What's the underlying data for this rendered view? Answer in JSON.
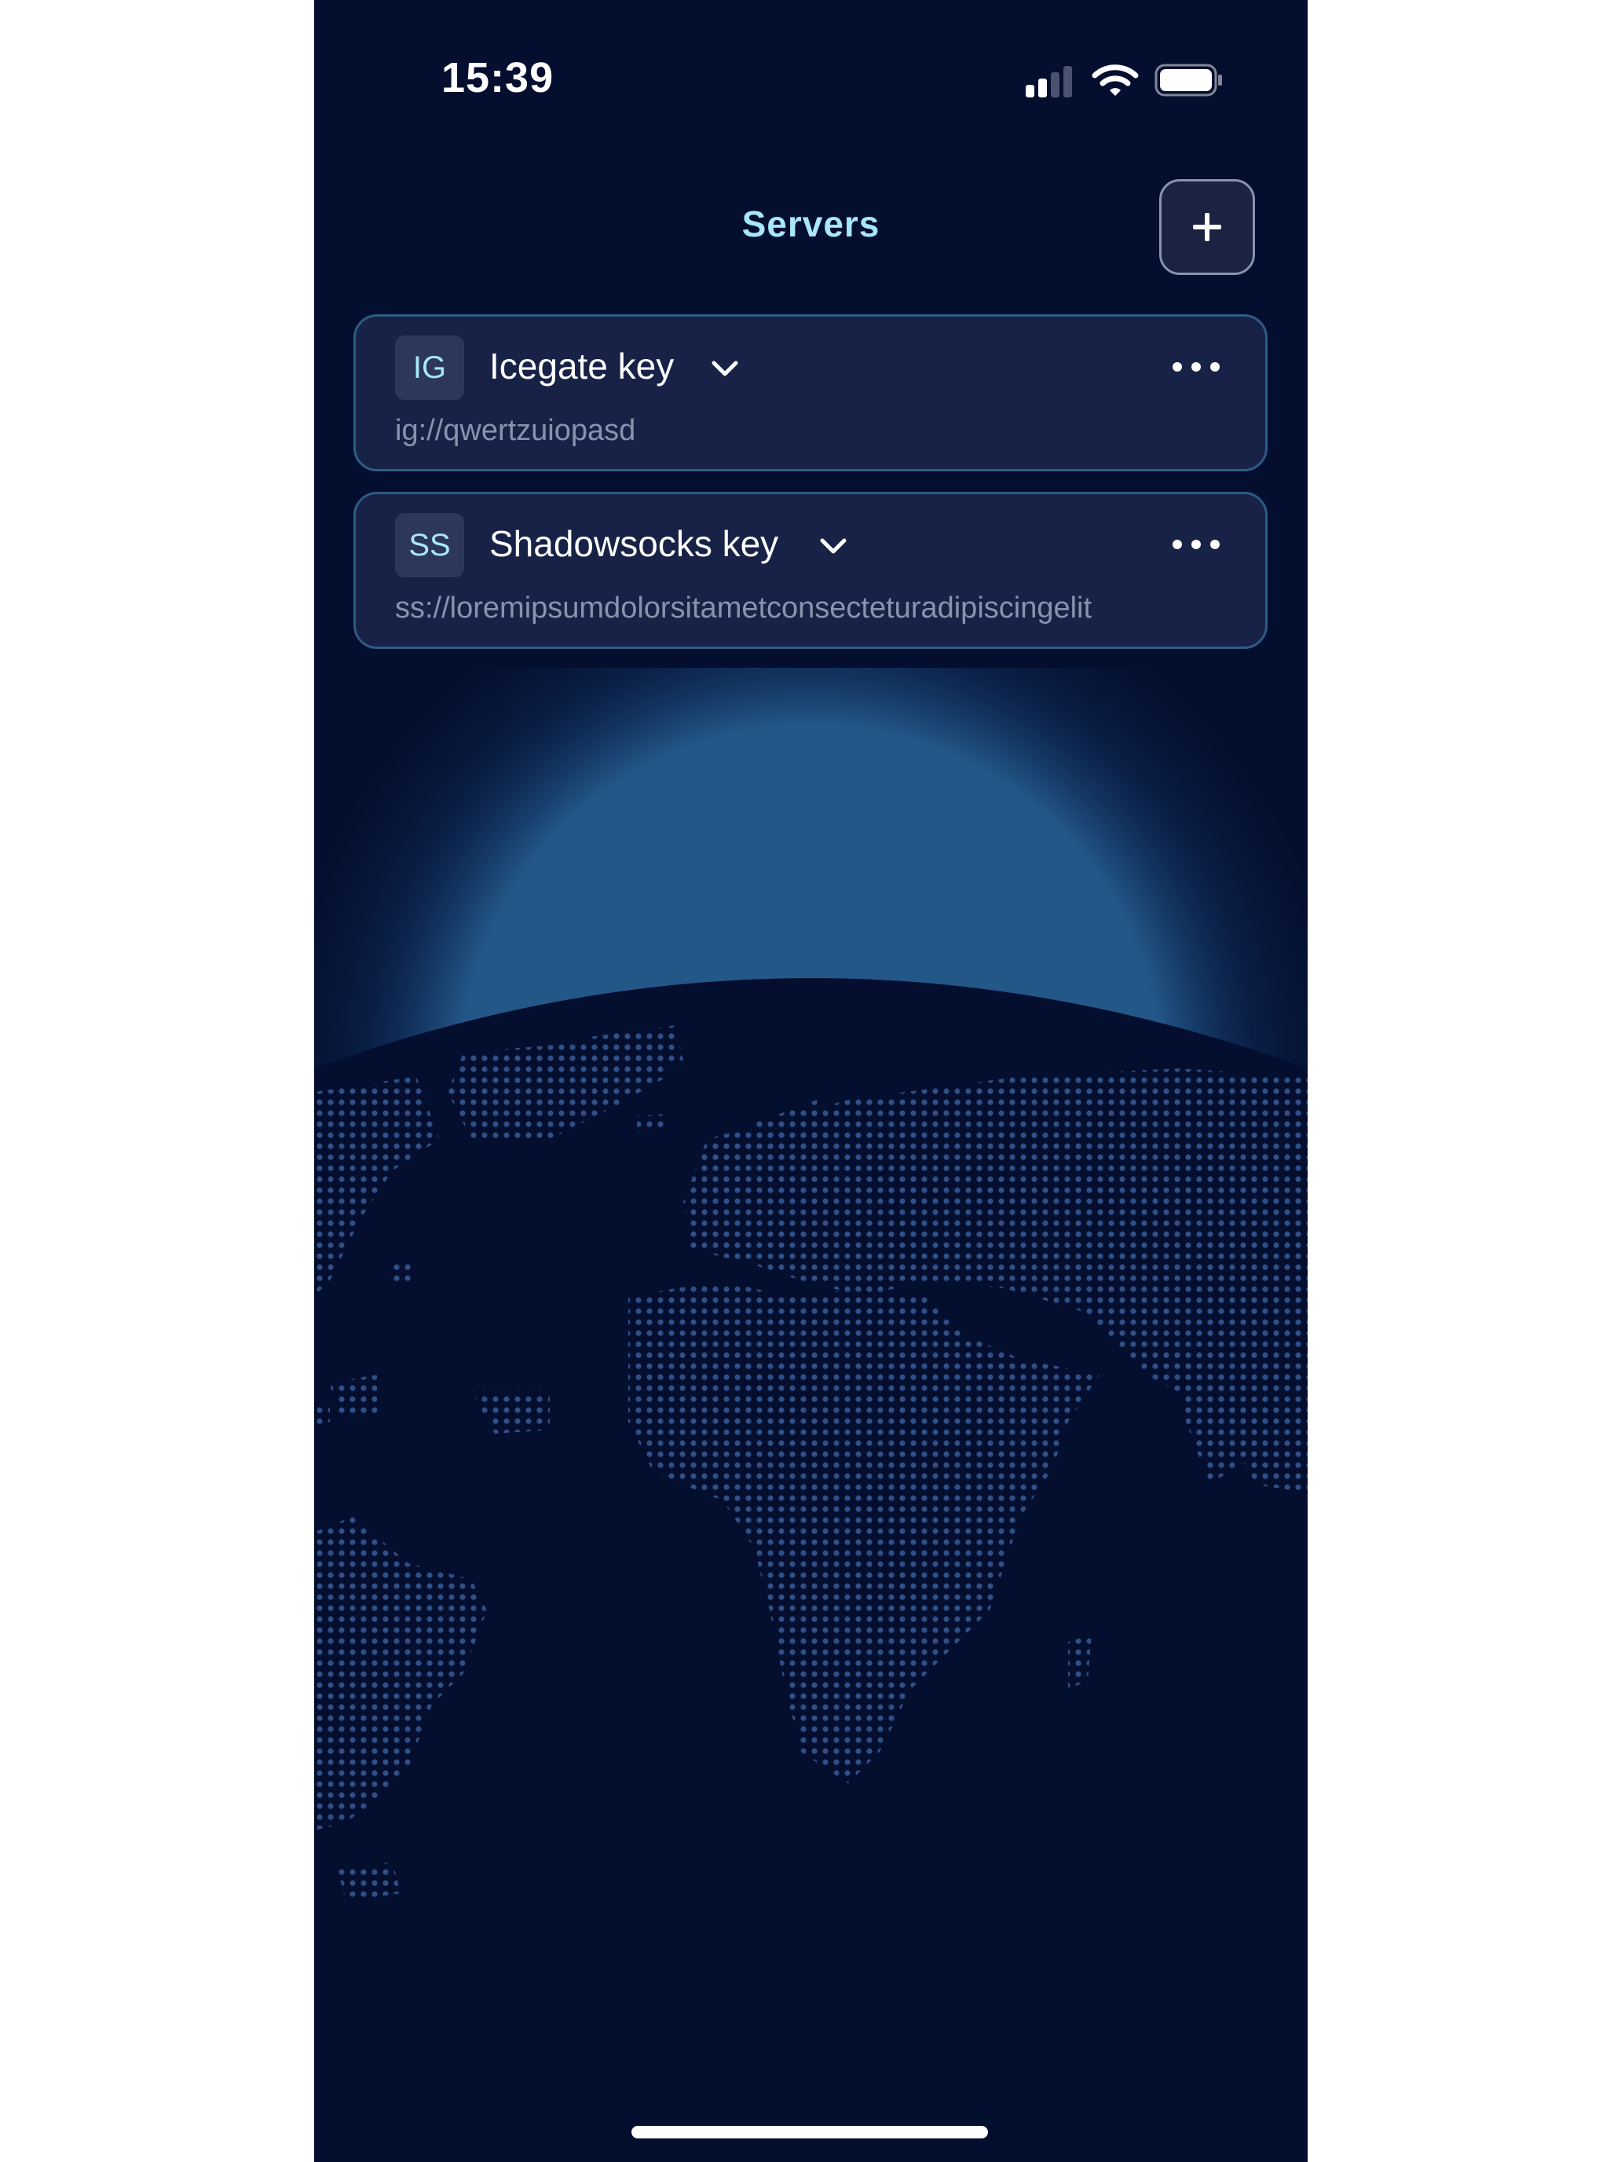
{
  "status_bar": {
    "time": "15:39",
    "signal_bars_active": 2,
    "signal_bars_total": 4,
    "battery_level": 1.0
  },
  "header": {
    "title": "Servers",
    "add_icon": "plus-icon"
  },
  "servers": [
    {
      "badge": "IG",
      "name": "Icegate key",
      "url": "ig://qwertzuiopasd",
      "expand_icon": "chevron-down-icon",
      "menu_icon": "more-horizontal-icon"
    },
    {
      "badge": "SS",
      "name": "Shadowsocks key",
      "url": "ss://loremipsumdolorsitametconsecteturadipiscingelit",
      "expand_icon": "chevron-down-icon",
      "menu_icon": "more-horizontal-icon"
    }
  ],
  "colors": {
    "background": "#040e2e",
    "accent": "#a8e6fb",
    "card": "#172246",
    "card_border": "#2d5b86",
    "muted_text": "#8a93ad",
    "map_dots": "#2f4f86",
    "glow": "#2d6fa6"
  }
}
